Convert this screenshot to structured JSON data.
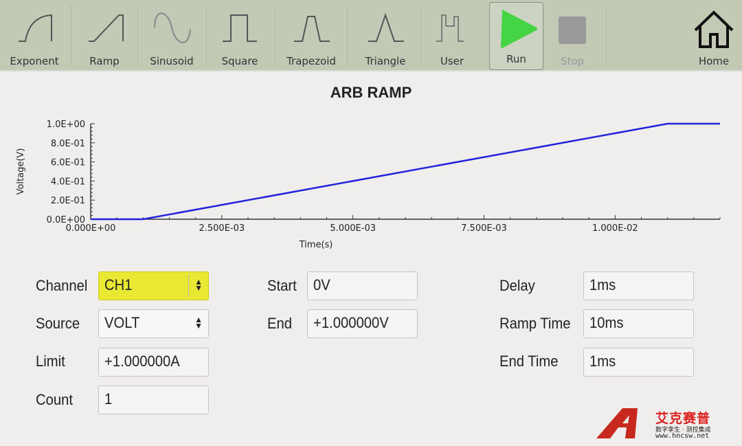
{
  "toolbar": {
    "items": [
      {
        "label": "Exponent",
        "icon": "exponent-wave-icon"
      },
      {
        "label": "Ramp",
        "icon": "ramp-wave-icon"
      },
      {
        "label": "Sinusoid",
        "icon": "sine-wave-icon"
      },
      {
        "label": "Square",
        "icon": "square-wave-icon"
      },
      {
        "label": "Trapezoid",
        "icon": "trapezoid-wave-icon"
      },
      {
        "label": "Triangle",
        "icon": "triangle-wave-icon"
      },
      {
        "label": "User",
        "icon": "user-wave-icon"
      },
      {
        "label": "Run",
        "icon": "play-icon",
        "color": "#44d444",
        "active": true
      },
      {
        "label": "Stop",
        "icon": "stop-icon",
        "color": "#999999",
        "disabled": true
      },
      {
        "label": "Home",
        "icon": "home-icon"
      }
    ]
  },
  "chart_data": {
    "type": "line",
    "title": "ARB RAMP",
    "xlabel": "Time(s)",
    "ylabel": "Voltage(V)",
    "xlim": [
      0,
      0.012
    ],
    "ylim": [
      0,
      1
    ],
    "xticks": [
      "0.000E+00",
      "2.500E-03",
      "5.000E-03",
      "7.500E-03",
      "1.000E-02"
    ],
    "yticks": [
      "0.0E+00",
      "2.0E-01",
      "4.0E-01",
      "6.0E-01",
      "8.0E-01",
      "1.0E+00"
    ],
    "series": [
      {
        "color": "#2222dd",
        "x": [
          0,
          0.001,
          0.011,
          0.012
        ],
        "y": [
          0,
          0,
          1,
          1
        ]
      }
    ]
  },
  "form": {
    "channel": {
      "label": "Channel",
      "value": "CH1"
    },
    "source": {
      "label": "Source",
      "value": "VOLT"
    },
    "limit": {
      "label": "Limit",
      "value": "+1.000000A"
    },
    "count": {
      "label": "Count",
      "value": "1"
    },
    "start": {
      "label": "Start",
      "value": "0V"
    },
    "end": {
      "label": "End",
      "value": "+1.000000V"
    },
    "delay": {
      "label": "Delay",
      "value": "1ms"
    },
    "ramp_time": {
      "label": "Ramp Time",
      "value": "10ms"
    },
    "end_time": {
      "label": "End Time",
      "value": "1ms"
    }
  },
  "watermark": {
    "name": "艾克赛普",
    "tagline": "数字孪生 · 测控集成",
    "url": "www.hncsw.net",
    "mark": "ACCEXP"
  }
}
